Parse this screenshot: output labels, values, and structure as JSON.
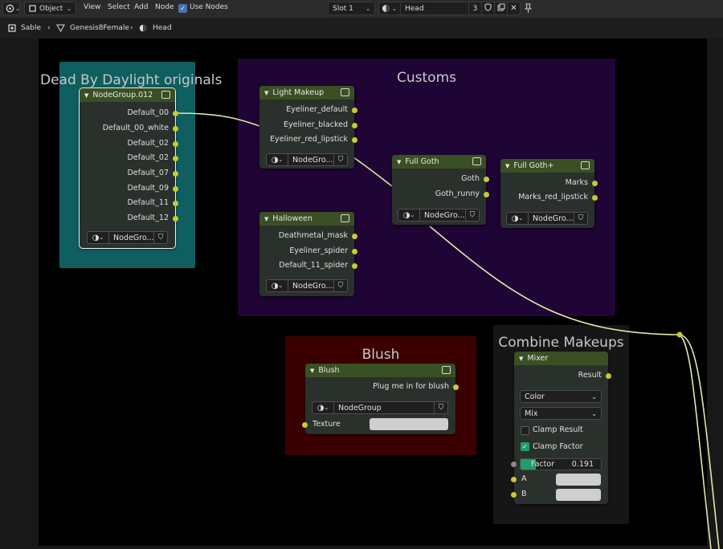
{
  "header": {
    "object_mode": "Object",
    "menus": [
      "View",
      "Select",
      "Add",
      "Node"
    ],
    "use_nodes_label": "Use Nodes",
    "slot": "Slot 1",
    "material_name": "Head",
    "user_count": "3"
  },
  "breadcrumbs": [
    "Sable",
    "Genesis8Female",
    "Head"
  ],
  "frames": {
    "dbd": "Dead By Daylight originals",
    "customs": "Customs",
    "blush": "Blush",
    "combine": "Combine Makeups"
  },
  "nodes": {
    "nodegroup012": {
      "title": "NodeGroup.012",
      "outputs": [
        "Default_00",
        "Default_00_white",
        "Default_02",
        "Default_02",
        "Default_07",
        "Default_09",
        "Default_11",
        "Default_12"
      ],
      "group_name": "NodeGro..."
    },
    "light_makeup": {
      "title": "Light Makeup",
      "outputs": [
        "Eyeliner_default",
        "Eyeliner_blacked",
        "Eyeliner_red_lipstick"
      ],
      "group_name": "NodeGro..."
    },
    "halloween": {
      "title": "Halloween",
      "outputs": [
        "Deathmetal_mask",
        "Eyeliner_spider",
        "Default_11_spider"
      ],
      "group_name": "NodeGro..."
    },
    "full_goth": {
      "title": "Full Goth",
      "outputs": [
        "Goth",
        "Goth_runny"
      ],
      "group_name": "NodeGro..."
    },
    "full_goth_plus": {
      "title": "Full Goth+",
      "outputs": [
        "Marks",
        "Marks_red_lipstick"
      ],
      "group_name": "NodeGro..."
    },
    "blush": {
      "title": "Blush",
      "output": "Plug me in for blush",
      "group_name": "NodeGroup",
      "input_texture": "Texture"
    },
    "mixer": {
      "title": "Mixer",
      "output": "Result",
      "data_type": "Color",
      "blend_mode": "Mix",
      "clamp_result_label": "Clamp Result",
      "clamp_result": false,
      "clamp_factor_label": "Clamp Factor",
      "clamp_factor": true,
      "factor_label": "Factor",
      "factor_value": "0.191",
      "factor": 0.191,
      "input_a": "A",
      "input_b": "B"
    }
  },
  "colors": {
    "link": "#e6e6a8",
    "socket_color": "#c9c934",
    "frame_teal": "#0f5e60",
    "frame_purple": "#1f0536",
    "frame_red": "#3a0000",
    "frame_grey": "#161616",
    "node_header": "#3a4f24",
    "accent_green": "#1f9e6a"
  }
}
